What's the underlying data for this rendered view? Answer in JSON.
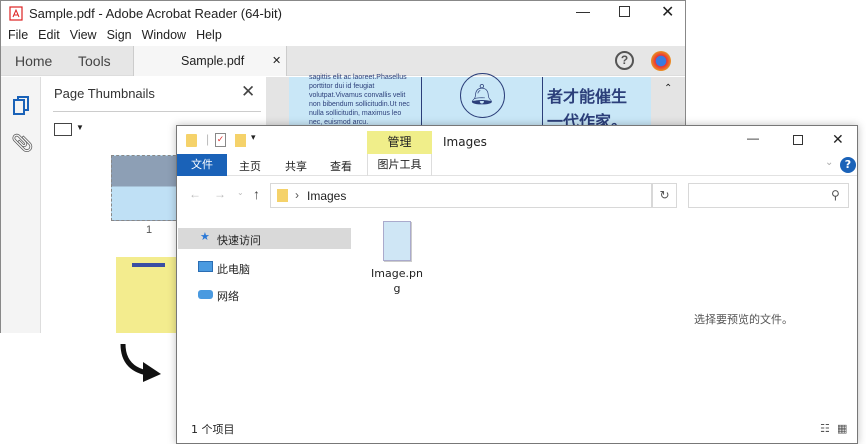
{
  "acrobat": {
    "title": "Sample.pdf - Adobe Acrobat Reader (64-bit)",
    "menu": [
      "File",
      "Edit",
      "View",
      "Sign",
      "Window",
      "Help"
    ],
    "tabs": {
      "home": "Home",
      "tools": "Tools",
      "doc": "Sample.pdf"
    },
    "panel_title": "Page Thumbnails",
    "thumb_page_1": "1",
    "doc_text": "sagittis elit ac laoreet.Phasellus porttitor dui id feugiat volutpat.Vivamus convallis velit non bibendum sollicitudin.Ut nec nulla sollicitudin, maximus leo nec, euismod arcu.",
    "doc_cjk_1": "者才能催生",
    "doc_cjk_2": "一代作家。"
  },
  "explorer": {
    "title": "Images",
    "context_tab": "管理",
    "context_sub": "图片工具",
    "ribbon_tabs": [
      "文件",
      "主页",
      "共享",
      "查看"
    ],
    "address": "Images",
    "search_placeholder": "",
    "nav": [
      "快速访问",
      "此电脑",
      "网络"
    ],
    "file": {
      "name_line1": "Image.pn",
      "name_line2": "g"
    },
    "preview_text": "选择要预览的文件。",
    "status": "1 个项目"
  },
  "colors": {
    "accent": "#1a62b8",
    "context": "#f0ee8a",
    "page": "#c9e7f7"
  }
}
